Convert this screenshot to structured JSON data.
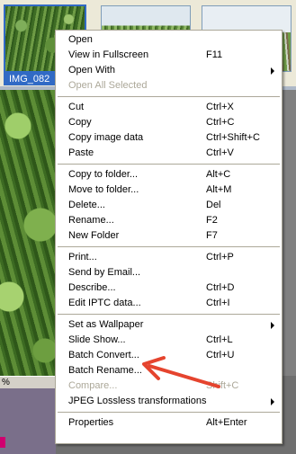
{
  "thumbnails": [
    {
      "caption": "IMG_082"
    },
    {
      "caption": ""
    },
    {
      "caption": ""
    }
  ],
  "status": {
    "percent_label": "%"
  },
  "annotation_color": "#e5442e",
  "context_menu": {
    "groups": [
      [
        {
          "label": "Open",
          "shortcut": "",
          "submenu": false,
          "enabled": true
        },
        {
          "label": "View in Fullscreen",
          "shortcut": "F11",
          "submenu": false,
          "enabled": true
        },
        {
          "label": "Open With",
          "shortcut": "",
          "submenu": true,
          "enabled": true
        },
        {
          "label": "Open All Selected",
          "shortcut": "",
          "submenu": false,
          "enabled": false
        }
      ],
      [
        {
          "label": "Cut",
          "shortcut": "Ctrl+X",
          "submenu": false,
          "enabled": true
        },
        {
          "label": "Copy",
          "shortcut": "Ctrl+C",
          "submenu": false,
          "enabled": true
        },
        {
          "label": "Copy image data",
          "shortcut": "Ctrl+Shift+C",
          "submenu": false,
          "enabled": true
        },
        {
          "label": "Paste",
          "shortcut": "Ctrl+V",
          "submenu": false,
          "enabled": true
        }
      ],
      [
        {
          "label": "Copy to folder...",
          "shortcut": "Alt+C",
          "submenu": false,
          "enabled": true
        },
        {
          "label": "Move to folder...",
          "shortcut": "Alt+M",
          "submenu": false,
          "enabled": true
        },
        {
          "label": "Delete...",
          "shortcut": "Del",
          "submenu": false,
          "enabled": true
        },
        {
          "label": "Rename...",
          "shortcut": "F2",
          "submenu": false,
          "enabled": true
        },
        {
          "label": "New Folder",
          "shortcut": "F7",
          "submenu": false,
          "enabled": true
        }
      ],
      [
        {
          "label": "Print...",
          "shortcut": "Ctrl+P",
          "submenu": false,
          "enabled": true
        },
        {
          "label": "Send by Email...",
          "shortcut": "",
          "submenu": false,
          "enabled": true
        },
        {
          "label": "Describe...",
          "shortcut": "Ctrl+D",
          "submenu": false,
          "enabled": true
        },
        {
          "label": "Edit IPTC data...",
          "shortcut": "Ctrl+I",
          "submenu": false,
          "enabled": true
        }
      ],
      [
        {
          "label": "Set as Wallpaper",
          "shortcut": "",
          "submenu": true,
          "enabled": true
        },
        {
          "label": "Slide Show...",
          "shortcut": "Ctrl+L",
          "submenu": false,
          "enabled": true
        },
        {
          "label": "Batch Convert...",
          "shortcut": "Ctrl+U",
          "submenu": false,
          "enabled": true
        },
        {
          "label": "Batch Rename...",
          "shortcut": "",
          "submenu": false,
          "enabled": true
        },
        {
          "label": "Compare...",
          "shortcut": "Shift+C",
          "submenu": false,
          "enabled": false
        },
        {
          "label": "JPEG Lossless transformations",
          "shortcut": "",
          "submenu": true,
          "enabled": true
        }
      ],
      [
        {
          "label": "Properties",
          "shortcut": "Alt+Enter",
          "submenu": false,
          "enabled": true
        }
      ]
    ]
  }
}
